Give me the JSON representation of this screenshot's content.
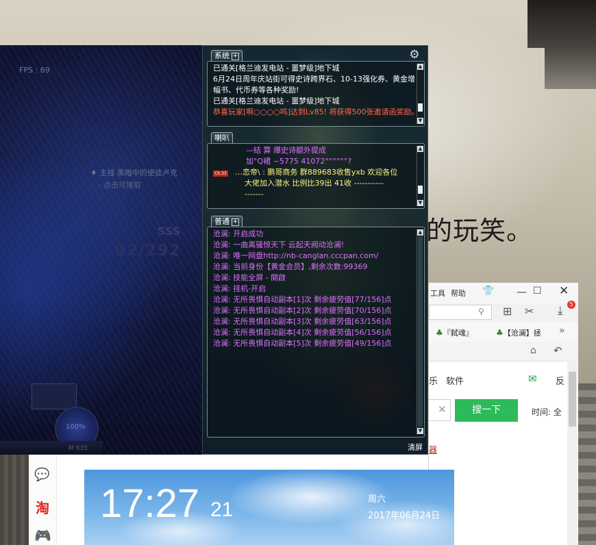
{
  "desktop": {
    "caption_fragment": "的玩笑。"
  },
  "game": {
    "fps": "FPS : 69",
    "quest_line1": "♦ 主线  黑暗中的使徒卢克",
    "quest_line2": "· 点击可接取",
    "faint_number": "SSS",
    "faint_number2": "92/292",
    "orb_text": "100%",
    "hud_text": "M 635"
  },
  "chat": {
    "gear_icon": "gear-icon",
    "system_tab": "系统",
    "system_lines": [
      {
        "text": "已通关[格兰迪发电站 - 噩梦级]地下城",
        "color": "#ffffff"
      },
      {
        "text": "6月24日周年庆站街可得史诗跨界石、10-13强化券、黄金增",
        "color": "#ffffff"
      },
      {
        "text": "幅书、代币券等各种奖励!",
        "color": "#ffffff"
      },
      {
        "text": "已通关[格兰迪发电站 - 噩梦级]地下城",
        "color": "#ffffff"
      },
      {
        "text": "恭喜玩家[啊○○○○呜]达到Lv85! 将获得500张邀请函奖励。",
        "color": "#ff6a4a"
      }
    ],
    "horn_tab": "喇叭",
    "horn_badge": "Ch.33",
    "horn_lines": [
      {
        "text": "—结 算  爆史诗额外提成",
        "color": "#e070ff"
      },
      {
        "text": "加°Q裙 ~5775 41072°°°°°°?",
        "color": "#e070ff"
      },
      {
        "text": "…恋帝\\ : 鹏哥商务 群889683收售yxb  欢迎各位",
        "color": "#fff27a"
      },
      {
        "text": "大佬加入潜水 比例比39出 41收  -----------",
        "color": "#fff27a"
      },
      {
        "text": "-------",
        "color": "#fff27a"
      }
    ],
    "normal_tab": "普通",
    "normal_lines": [
      {
        "text": "沧澜: 开启成功",
        "color": "#e070ff"
      },
      {
        "text": "沧澜: 一曲离骚惊天下 云起天阙动沧澜!",
        "color": "#e070ff"
      },
      {
        "text": "沧澜: 唯一网盘http://nb-canglan.cccpan.com/",
        "color": "#e070ff"
      },
      {
        "text": "沧澜: 当前身份【黄金会员】,剩余次数:99369",
        "color": "#e070ff"
      },
      {
        "text": "沧澜: 技能全屏 - 開啟",
        "color": "#e070ff"
      },
      {
        "text": "沧澜: 挂机-开启",
        "color": "#e070ff"
      },
      {
        "text": "沧澜: 无所畏惧自动副本[1]次  剩余疲劳值[77/156]点",
        "color": "#e070ff"
      },
      {
        "text": "沧澜: 无所畏惧自动副本[2]次  剩余疲劳值[70/156]点",
        "color": "#e070ff"
      },
      {
        "text": "沧澜: 无所畏惧自动副本[3]次  剩余疲劳值[63/156]点",
        "color": "#e070ff"
      },
      {
        "text": "沧澜: 无所畏惧自动副本[4]次  剩余疲劳值[56/156]点",
        "color": "#e070ff"
      },
      {
        "text": "沧澜: 无所畏惧自动副本[5]次  剩余疲劳值[49/156]点",
        "color": "#e070ff"
      }
    ],
    "clear_label": "清屏"
  },
  "browser": {
    "menu_tools": "工具",
    "menu_help": "帮助",
    "min_glyph": "—",
    "max_glyph": "☐",
    "close_glyph": "✕",
    "download_badge": "5",
    "bookmarks": [
      {
        "label": "『弑魂』"
      },
      {
        "label": "【沧澜】拯"
      }
    ],
    "nav_tab1": "乐",
    "nav_tab2": "软件",
    "feedback": "反",
    "search_button": "搜一下",
    "time_label": "时间: 全",
    "link_text": "器"
  },
  "sidebar": {
    "wechat_icon": "wechat-icon",
    "taobao_label": "淘",
    "game_icon": "gamepad-icon"
  },
  "weather": {
    "time": "17:27",
    "seconds": "21",
    "weekday": "周六",
    "date": "2017年06月24日"
  }
}
